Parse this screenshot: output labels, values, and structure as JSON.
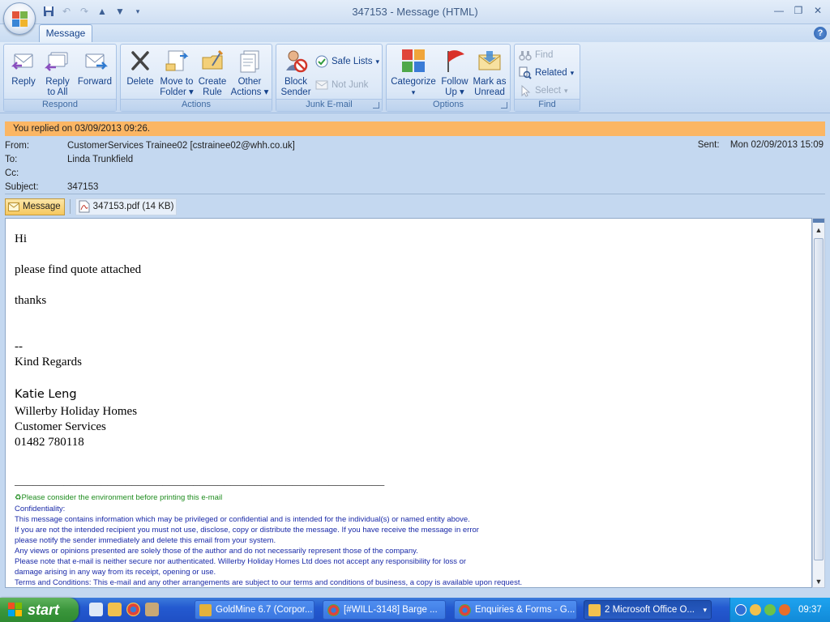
{
  "window": {
    "title": "347153 - Message (HTML)"
  },
  "tabs": [
    {
      "label": "Message"
    }
  ],
  "ribbon": {
    "respond": {
      "label": "Respond",
      "reply": "Reply",
      "reply_all": [
        "Reply",
        "to All"
      ],
      "forward": "Forward"
    },
    "actions": {
      "label": "Actions",
      "delete": "Delete",
      "move": [
        "Move to",
        "Folder"
      ],
      "create_rule": [
        "Create",
        "Rule"
      ],
      "other": [
        "Other",
        "Actions"
      ]
    },
    "junk": {
      "label": "Junk E-mail",
      "block": [
        "Block",
        "Sender"
      ],
      "safe_lists": "Safe Lists",
      "not_junk": "Not Junk"
    },
    "options": {
      "label": "Options",
      "categorize": "Categorize",
      "follow_up": [
        "Follow",
        "Up"
      ],
      "mark_unread": [
        "Mark as",
        "Unread"
      ]
    },
    "find": {
      "label": "Find",
      "find": "Find",
      "related": "Related",
      "select": "Select"
    }
  },
  "infobar": "You replied on 03/09/2013 09:26.",
  "header": {
    "from_label": "From:",
    "from": "CustomerServices Trainee02 [cstrainee02@whh.co.uk]",
    "to_label": "To:",
    "to": "Linda Trunkfield",
    "cc_label": "Cc:",
    "cc": "",
    "subject_label": "Subject:",
    "subject": "347153",
    "sent_label": "Sent:",
    "sent": "Mon 02/09/2013 15:09"
  },
  "attachments": {
    "message_tab": "Message",
    "file": "347153.pdf (14 KB)"
  },
  "body": {
    "greeting": "Hi",
    "line1": "please find quote attached",
    "line2": "thanks",
    "sig_dash": "--",
    "regards": "Kind Regards",
    "name": "Katie Leng",
    "company": "Willerby Holiday Homes",
    "dept": "Customer Services",
    "phone": "01482 780118",
    "divider": "____________________________________________________________",
    "env": "Please consider the environment before printing this e-mail",
    "conf_title": "Confidentiality:",
    "disclaimer": [
      "This message contains information which may be privileged or confidential and is intended for the individual(s) or named entity above.",
      "If you are not the intended recipient you must not use, disclose, copy or distribute the message. If you have receive the message in error",
      "please notify the sender immediately and delete this email from your system.",
      "Any views or opinions presented are solely those of the author and do not necessarily represent those of the company.",
      "Please note that e-mail is neither secure nor authenticated. Willerby Holiday Homes Ltd does not accept any responsibility for loss or",
      "damage arising in any way from its receipt, opening or use.",
      "Terms and Conditions: This e-mail and any other arrangements are subject to our terms and conditions of business, a copy is available upon request."
    ]
  },
  "taskbar": {
    "start": "start",
    "tasks": [
      "GoldMine 6.7 (Corpor...",
      "[#WILL-3148] Barge ...",
      "Enquiries & Forms - G...",
      "2 Microsoft Office O..."
    ],
    "clock": "09:37"
  }
}
